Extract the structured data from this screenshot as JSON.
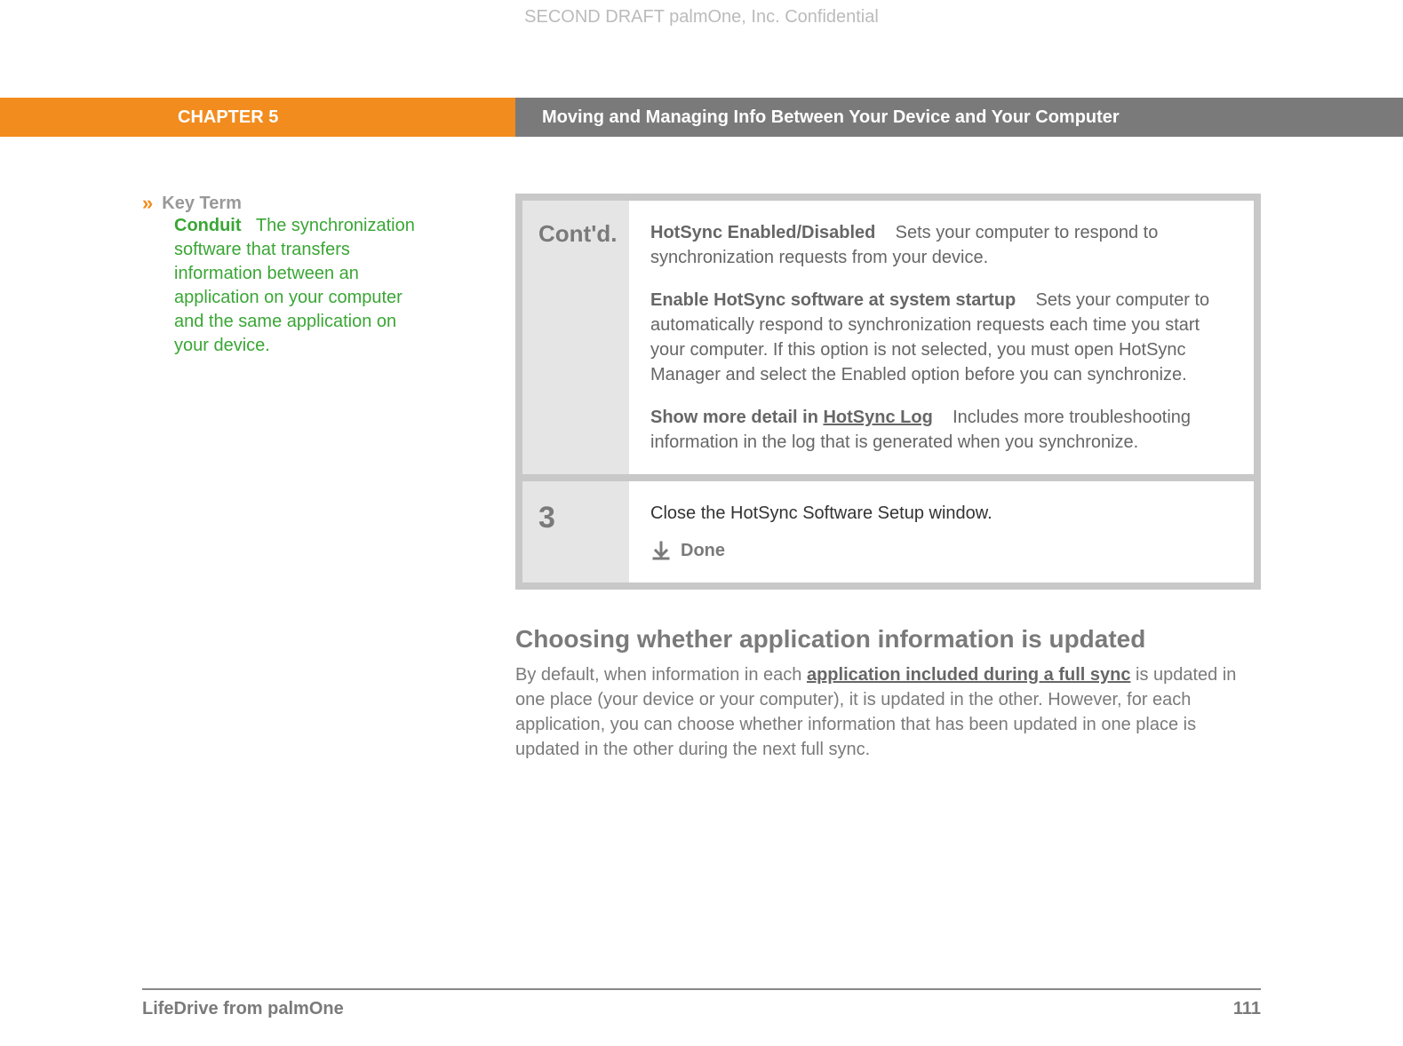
{
  "watermark": "SECOND DRAFT palmOne, Inc.  Confidential",
  "chapter_label": "CHAPTER 5",
  "chapter_title": "Moving and Managing Info Between Your Device and Your Computer",
  "sidebar": {
    "keyterm_label": "Key Term",
    "term": "Conduit",
    "definition": "The synchronization software that transfers information between an application on your computer and the same application on your device."
  },
  "steps": {
    "contd_label": "Cont'd.",
    "contd_items": [
      {
        "bold": "HotSync Enabled/Disabled",
        "text": "Sets your computer to respond to synchronization requests from your device."
      },
      {
        "bold": "Enable HotSync software at system startup",
        "text": "Sets your computer to automatically respond to synchronization requests each time you start your computer. If this option is not selected, you must open HotSync Manager and select the Enabled option before you can synchronize."
      },
      {
        "bold_before": "Show more detail in ",
        "link": "HotSync Log",
        "text": "Includes more troubleshooting information in the log that is generated when you synchronize."
      }
    ],
    "step3_num": "3",
    "step3_action": "Close the HotSync Software Setup window.",
    "done_label": "Done"
  },
  "section": {
    "heading": "Choosing whether application information is updated",
    "body_before": "By default, when information in each ",
    "body_link": "application included during a full sync",
    "body_after": " is updated in one place (your device or your computer), it is updated in the other. However, for each application, you can choose whether information that has been updated in one place is updated in the other during the next full sync."
  },
  "footer": {
    "left": "LifeDrive from palmOne",
    "page": "111"
  }
}
